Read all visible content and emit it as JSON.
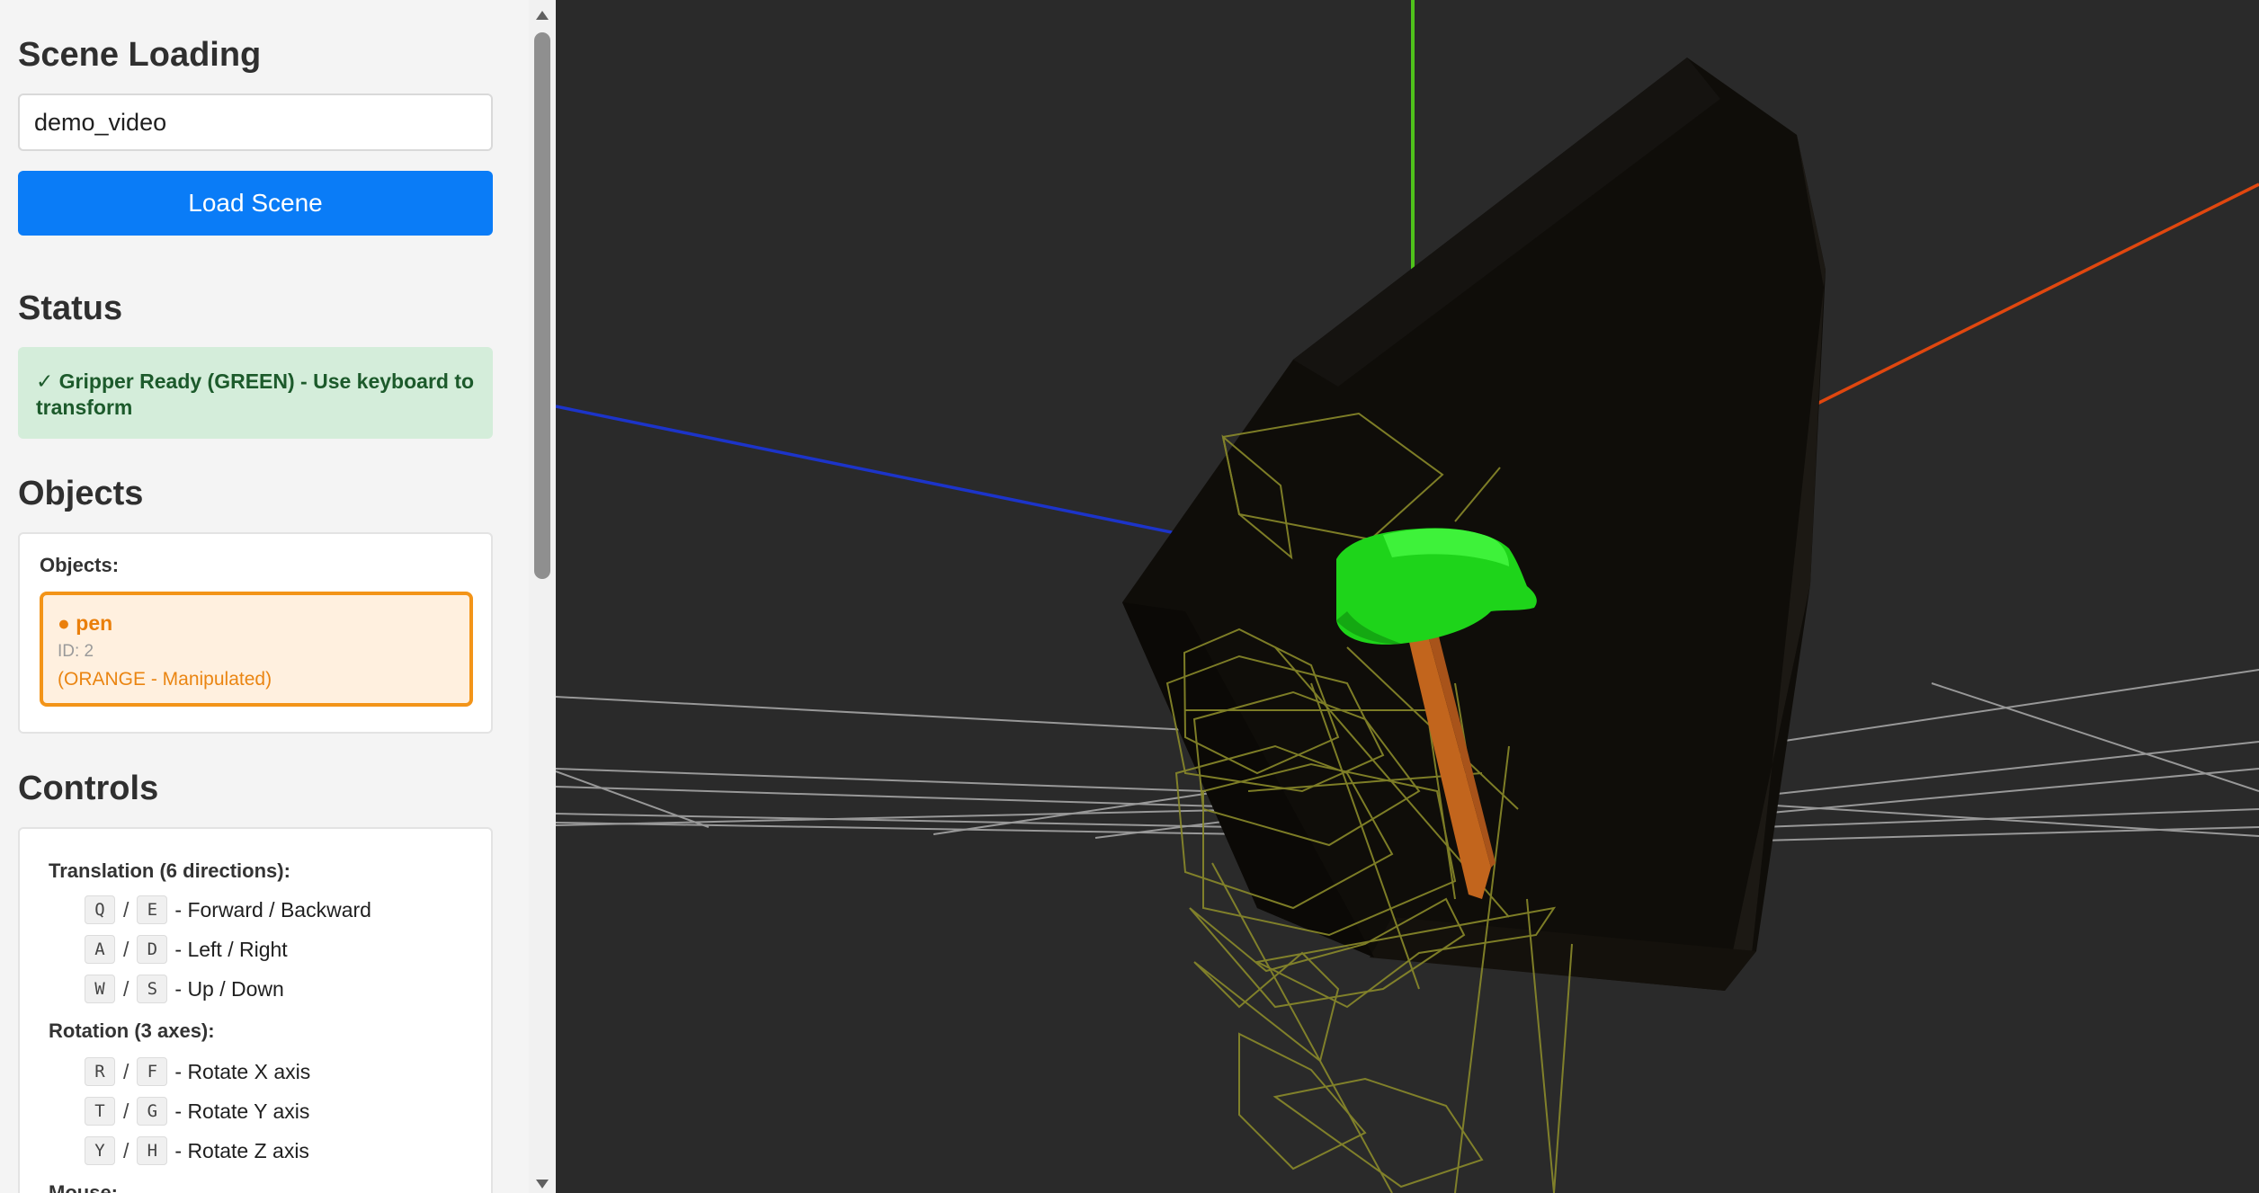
{
  "sidebar": {
    "scene_loading": {
      "title": "Scene Loading",
      "input_value": "demo_video",
      "load_button_label": "Load Scene"
    },
    "status": {
      "title": "Status",
      "message": "✓ Gripper Ready (GREEN) - Use keyboard to transform",
      "color": "#d4edda"
    },
    "objects": {
      "title": "Objects",
      "list_heading": "Objects:",
      "items": [
        {
          "name": "● pen",
          "id_text": "ID: 2",
          "state": "(ORANGE - Manipulated)",
          "color": "#f39418"
        }
      ]
    },
    "controls": {
      "title": "Controls",
      "translation_title": "Translation (6 directions):",
      "translation": [
        {
          "key1": "Q",
          "key2": "E",
          "desc": "- Forward / Backward"
        },
        {
          "key1": "A",
          "key2": "D",
          "desc": "- Left / Right"
        },
        {
          "key1": "W",
          "key2": "S",
          "desc": "- Up / Down"
        }
      ],
      "rotation_title": "Rotation (3 axes):",
      "rotation": [
        {
          "key1": "R",
          "key2": "F",
          "desc": "- Rotate X axis"
        },
        {
          "key1": "T",
          "key2": "G",
          "desc": "- Rotate Y axis"
        },
        {
          "key1": "Y",
          "key2": "H",
          "desc": "- Rotate Z axis"
        }
      ],
      "mouse_title": "Mouse:",
      "separator": "/"
    }
  },
  "viewport": {
    "background": "#2a2a2a",
    "axis_colors": {
      "x": "#e0470f",
      "y": "#4fc21b",
      "z": "#1c34c9"
    },
    "gripper_color": "#1ed41a",
    "pen_color": "#c2651d",
    "wireframe_color": "#8a8a2a",
    "grid_color": "#bdbdbd"
  }
}
